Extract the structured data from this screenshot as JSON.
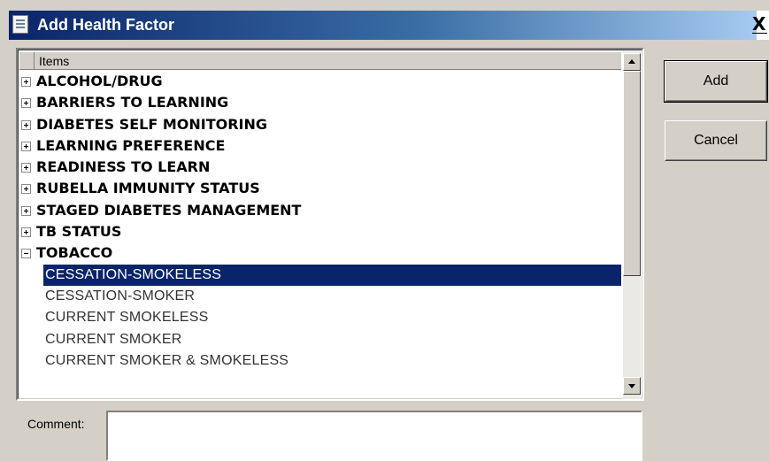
{
  "window": {
    "title": "Add Health Factor",
    "close_glyph": "X"
  },
  "tree": {
    "header": "Items",
    "items": [
      {
        "label": "ALCOHOL/DRUG",
        "type": "category",
        "expanded": false
      },
      {
        "label": "BARRIERS TO LEARNING",
        "type": "category",
        "expanded": false
      },
      {
        "label": "DIABETES SELF MONITORING",
        "type": "category",
        "expanded": false
      },
      {
        "label": "LEARNING PREFERENCE",
        "type": "category",
        "expanded": false
      },
      {
        "label": "READINESS TO LEARN",
        "type": "category",
        "expanded": false
      },
      {
        "label": "RUBELLA IMMUNITY STATUS",
        "type": "category",
        "expanded": false
      },
      {
        "label": "STAGED DIABETES MANAGEMENT",
        "type": "category",
        "expanded": false
      },
      {
        "label": "TB STATUS",
        "type": "category",
        "expanded": false
      },
      {
        "label": "TOBACCO",
        "type": "category",
        "expanded": true
      },
      {
        "label": "CESSATION-SMOKELESS",
        "type": "child",
        "selected": true
      },
      {
        "label": "CESSATION-SMOKER",
        "type": "child",
        "selected": false
      },
      {
        "label": "CURRENT SMOKELESS",
        "type": "child",
        "selected": false
      },
      {
        "label": "CURRENT SMOKER",
        "type": "child",
        "selected": false
      },
      {
        "label": "CURRENT SMOKER & SMOKELESS",
        "type": "child",
        "selected": false
      }
    ],
    "scroll_position": 0.0
  },
  "buttons": {
    "add": "Add",
    "cancel": "Cancel"
  },
  "comment": {
    "label": "Comment:",
    "value": ""
  },
  "colors": {
    "title_bar_start": "#0a246a",
    "title_bar_end": "#a6caf0",
    "selection": "#0a246a",
    "dialog_face": "#d4d0c8"
  }
}
